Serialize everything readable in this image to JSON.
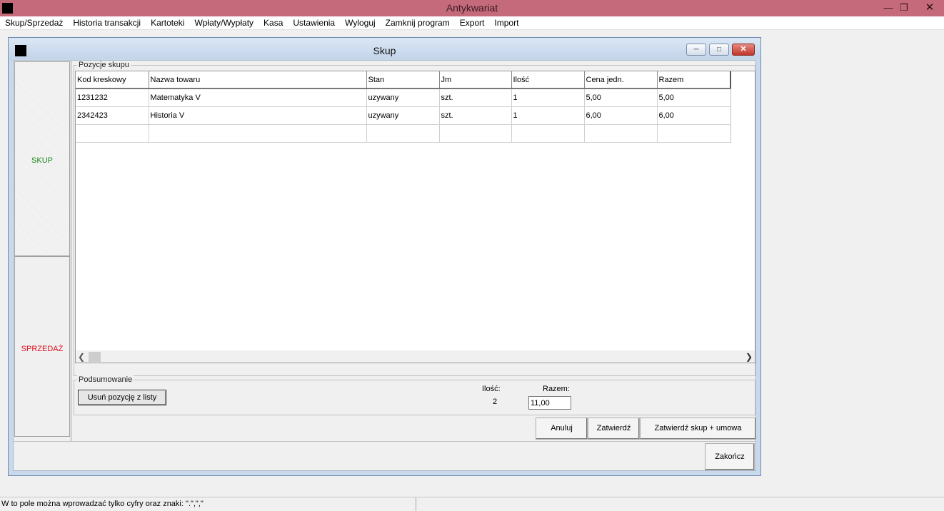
{
  "app": {
    "title": "Antykwariat"
  },
  "menu": [
    "Skup/Sprzedaż",
    "Historia transakcji",
    "Kartoteki",
    "Wpłaty/Wypłaty",
    "Kasa",
    "Ustawienia",
    "Wyloguj",
    "Zamknij program",
    "Export",
    "Import"
  ],
  "window": {
    "title": "Skup"
  },
  "tabs": {
    "skup": "SKUP",
    "sprzedaz": "SPRZEDAŻ"
  },
  "positions": {
    "legend": "Pozycje skupu",
    "columns": [
      "Kod kreskowy",
      "Nazwa towaru",
      "Stan",
      "Jm",
      "Ilość",
      "Cena jedn.",
      "Razem"
    ],
    "rows": [
      [
        "1231232",
        "Matematyka V",
        "uzywany",
        "szt.",
        "1",
        "5,00",
        "5,00"
      ],
      [
        "2342423",
        "Historia V",
        "uzywany",
        "szt.",
        "1",
        "6,00",
        "6,00"
      ],
      [
        "",
        "",
        "",
        "",
        "",
        "",
        ""
      ]
    ]
  },
  "summary": {
    "legend": "Podsumowanie",
    "remove_label": "Usuń pozycję z listy",
    "qty_label": "Ilość:",
    "qty_value": "2",
    "total_label": "Razem:",
    "total_value": "11,00"
  },
  "buttons": {
    "cancel": "Anuluj",
    "confirm": "Zatwierdź",
    "confirm_contract": "Zatwierdź skup + umowa",
    "finish": "Zakończ"
  },
  "status": {
    "text": "W to pole można wprowadzać tylko cyfry oraz znaki: \".\",\",\""
  },
  "colors": {
    "titlebar": "#c46a7a",
    "skup_tab": "#1f8a1f",
    "sprzedaz_tab": "#e01020"
  }
}
